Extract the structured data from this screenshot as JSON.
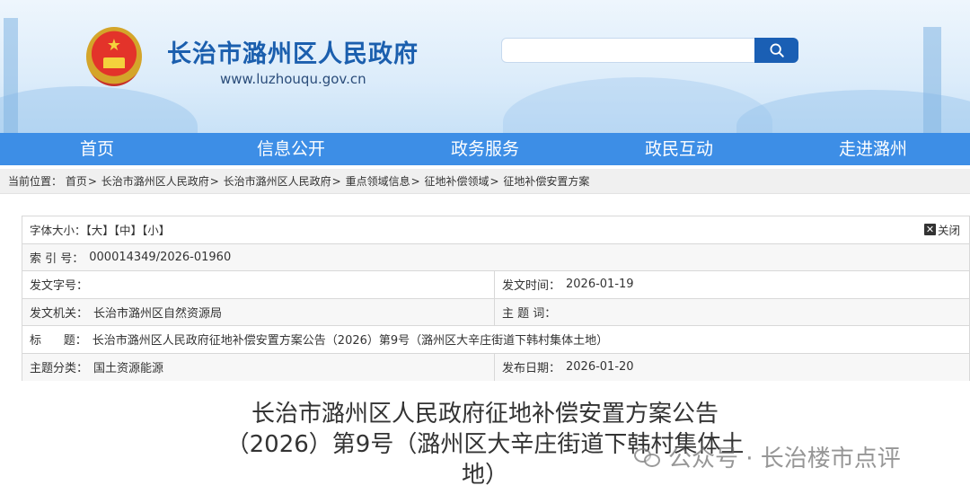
{
  "header": {
    "site_title": "长治市潞州区人民政府",
    "site_url": "www.luzhouqu.gov.cn",
    "search_placeholder": ""
  },
  "nav": {
    "items": [
      "首页",
      "信息公开",
      "政务服务",
      "政民互动",
      "走进潞州"
    ]
  },
  "breadcrumb": {
    "label": "当前位置：",
    "items": [
      "首页",
      "长治市潞州区人民政府",
      "长治市潞州区人民政府",
      "重点领域信息",
      "征地补偿领域",
      "征地补偿安置方案"
    ],
    "separator": ">"
  },
  "info": {
    "font_size_label": "字体大小：",
    "font_large": "【大】",
    "font_medium": "【中】",
    "font_small": "【小】",
    "close_label": "关闭",
    "index_label": "索 引 号：",
    "index_value": "000014349/2026-01960",
    "doc_no_label": "发文字号：",
    "doc_no_value": "",
    "issue_time_label": "发文时间：",
    "issue_time_value": "2026-01-19",
    "issuer_label": "发文机关：",
    "issuer_value": "长治市潞州区自然资源局",
    "keywords_label": "主 题 词：",
    "keywords_value": "",
    "title_label": "标      题：",
    "title_value": "长治市潞州区人民政府征地补偿安置方案公告（2026）第9号（潞州区大辛庄街道下韩村集体土地）",
    "category_label": "主题分类：",
    "category_value": "国土资源能源",
    "publish_date_label": "发布日期：",
    "publish_date_value": "2026-01-20"
  },
  "document": {
    "title_line1": "长治市潞州区人民政府征地补偿安置方案公告",
    "title_line2": "（2026）第9号（潞州区大辛庄街道下韩村集体土",
    "title_line3": "地）"
  },
  "watermark": {
    "text": "公众号 · 长治楼市点评"
  }
}
